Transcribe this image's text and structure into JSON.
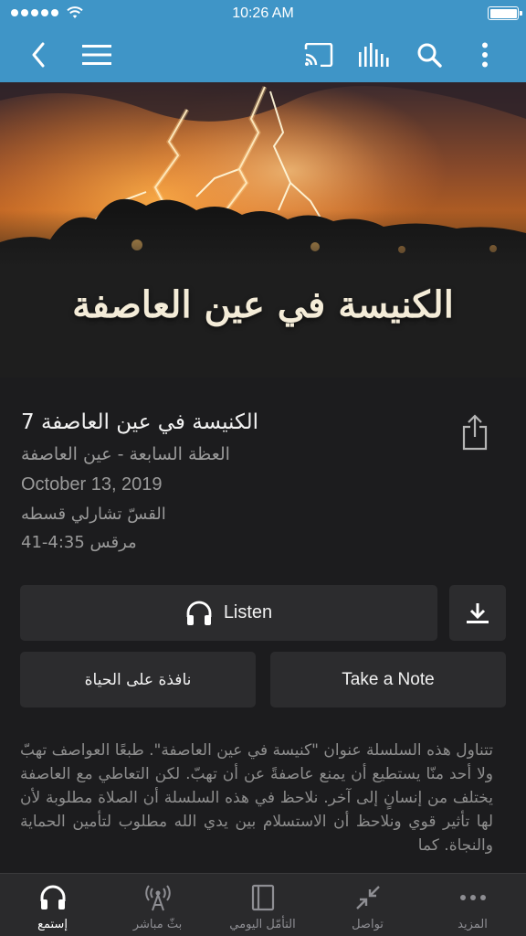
{
  "status_bar": {
    "time": "10:26 AM"
  },
  "nav": {
    "back_icon": "chevron-left-icon",
    "menu_icon": "hamburger-menu-icon",
    "cast_icon": "cast-icon",
    "audio_icon": "audio-levels-icon",
    "search_icon": "search-icon",
    "more_icon": "vertical-dots-icon"
  },
  "hero": {
    "title": "الكنيسة في عين العاصفة"
  },
  "sermon": {
    "title": "الكنيسة في عين العاصفة 7",
    "subtitle": "العظة السابعة - عين العاصفة",
    "date": "October 13, 2019",
    "speaker": "القسّ تشارلي قسطه",
    "reference": "مرقس 4:35-41"
  },
  "actions": {
    "listen_label": "Listen",
    "life_window_label": "نافذة على الحياة",
    "take_note_label": "Take a Note"
  },
  "description": "تتناول هذه السلسلة عنوان \"كنيسة في عين العاصفة\". طبعًا العواصف تهبّ ولا أحد منّا يستطيع أن يمنع عاصفةً عن أن تهبّ. لكن التعاطي مع العاصفة يختلف من إنسانٍ إلى آخر. نلاحظ في هذه السلسلة أن الصلاة مطلوبة لأن لها تأثير قوي ونلاحظ أن الاستسلام بين يدي الله مطلوب لتأمين الحماية والنجاة. كما",
  "tabs": [
    {
      "label": "إستمع",
      "icon": "headphones-icon",
      "active": true
    },
    {
      "label": "بثّ مباشر",
      "icon": "broadcast-antenna-icon",
      "active": false
    },
    {
      "label": "التأمّل اليومي",
      "icon": "book-icon",
      "active": false
    },
    {
      "label": "تواصل",
      "icon": "arrows-inward-icon",
      "active": false
    },
    {
      "label": "المزيد",
      "icon": "more-dots-icon",
      "active": false
    }
  ],
  "colors": {
    "header": "#3f95c7",
    "background": "#1c1c1e",
    "button": "#2c2c2e",
    "tab_bar": "#2a2a2c"
  }
}
